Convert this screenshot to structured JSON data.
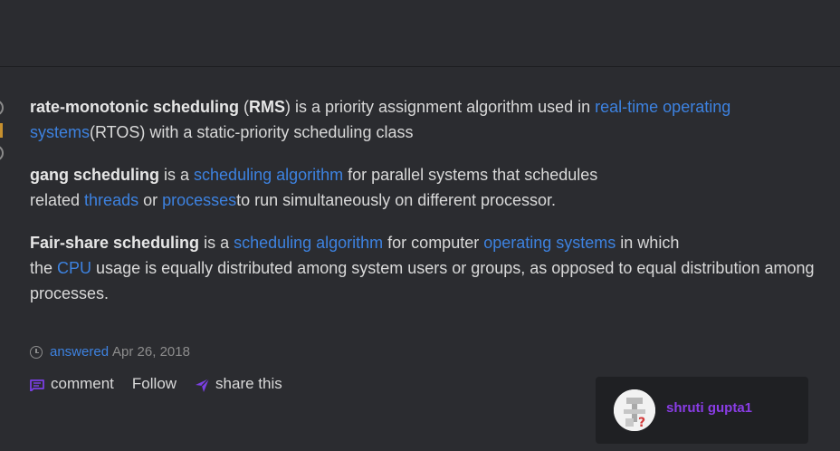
{
  "answer": {
    "p1": {
      "term": "rate-monotonic scheduling",
      "t1": " (",
      "abbr": "RMS",
      "t2": ") is a priority assignment algorithm used in ",
      "link1": "real-time operating systems",
      "t3": "(RTOS) with a static-priority scheduling class"
    },
    "p2": {
      "term": "gang scheduling",
      "t1": " is a ",
      "link1": "scheduling algorithm",
      "t2": " for parallel systems that schedules",
      "t3": "related ",
      "link2": "threads",
      "t4": " or ",
      "link3": "processes",
      "t5": "to run simultaneously on different processor."
    },
    "p3": {
      "term": "Fair-share scheduling",
      "t1": " is a ",
      "link1": "scheduling algorithm",
      "t2": " for computer ",
      "link2": "operating systems",
      "t3": " in which",
      "t4": "the ",
      "link3": "CPU",
      "t5": " usage is equally distributed among system users or groups, as opposed to equal distribution among processes."
    }
  },
  "meta": {
    "answered_label": "answered",
    "date": "Apr 26, 2018"
  },
  "actions": {
    "comment": "comment",
    "follow": "Follow",
    "share": "share this"
  },
  "user": {
    "name": "shruti gupta1"
  },
  "colors": {
    "background": "#2b2c30",
    "link": "#3d82e0",
    "user_name": "#8a3de6",
    "icon_purple": "#7b3fe4"
  }
}
